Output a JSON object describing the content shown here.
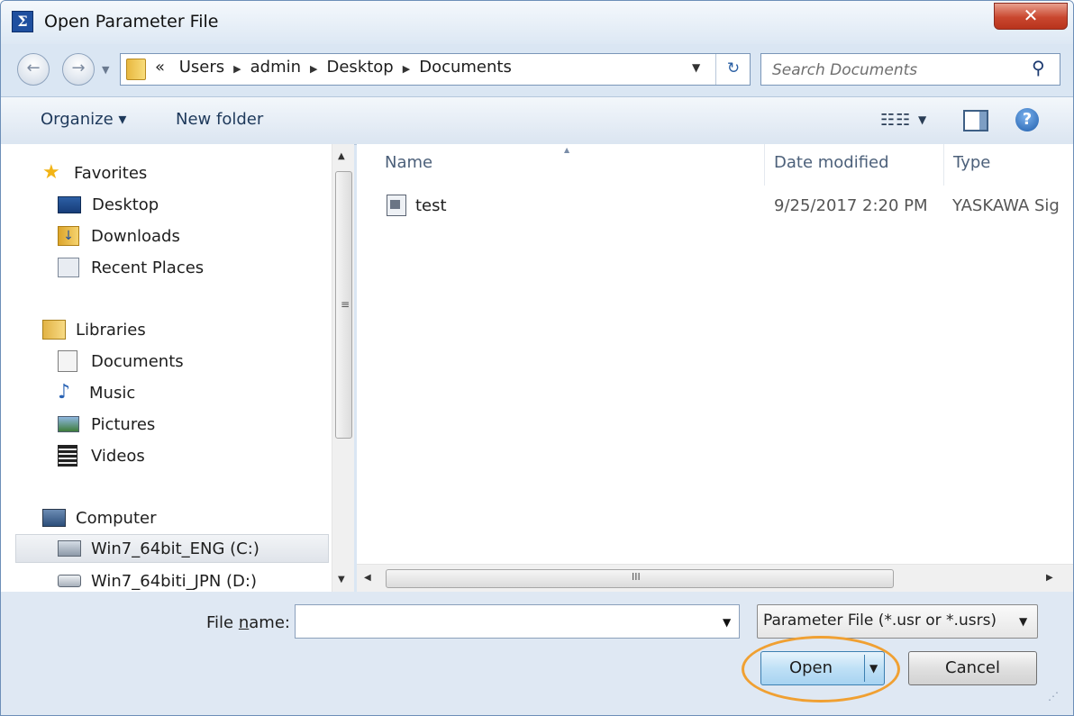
{
  "window": {
    "title": "Open Parameter File",
    "close_glyph": "✕"
  },
  "nav": {
    "back_glyph": "←",
    "forward_glyph": "→",
    "history_glyph": "▼",
    "breadcrumb": [
      "Users",
      "admin",
      "Desktop",
      "Documents"
    ],
    "breadcrumb_prefix": "«",
    "sep_glyph": "▶",
    "dropdown_glyph": "▼",
    "refresh_glyph": "↻",
    "search_placeholder": "Search Documents",
    "search_glyph": "⚲"
  },
  "toolbar": {
    "organize": "Organize ▾",
    "new_folder": "New folder",
    "view_glyph": "☷☷",
    "view_drop": "▼",
    "help": "?"
  },
  "sidebar": {
    "favorites": {
      "label": "Favorites",
      "items": [
        "Desktop",
        "Downloads",
        "Recent Places"
      ]
    },
    "libraries": {
      "label": "Libraries",
      "items": [
        "Documents",
        "Music",
        "Pictures",
        "Videos"
      ]
    },
    "computer": {
      "label": "Computer",
      "items": [
        "Win7_64bit_ENG (C:)",
        "Win7_64biti_JPN (D:)"
      ]
    }
  },
  "columns": {
    "name": "Name",
    "date": "Date modified",
    "type": "Type",
    "sort_glyph": "▲"
  },
  "files": [
    {
      "name": "test",
      "date": "9/25/2017 2:20 PM",
      "type": "YASKAWA Sig"
    }
  ],
  "scrollbar": {
    "up": "▲",
    "down": "▼",
    "left": "◀",
    "right": "▶",
    "grip": "≡",
    "hgrip": "III"
  },
  "bottom": {
    "file_name_label_pre": "File ",
    "file_name_label_u": "n",
    "file_name_label_post": "ame:",
    "file_name_value": "",
    "drop_glyph": "▼",
    "filter": "Parameter File (*.usr or *.usrs)",
    "open": "Open",
    "cancel": "Cancel",
    "resize_glyph": "⋰"
  },
  "colors": {
    "highlight": "#f0a032",
    "accent": "#3c7fb1"
  }
}
